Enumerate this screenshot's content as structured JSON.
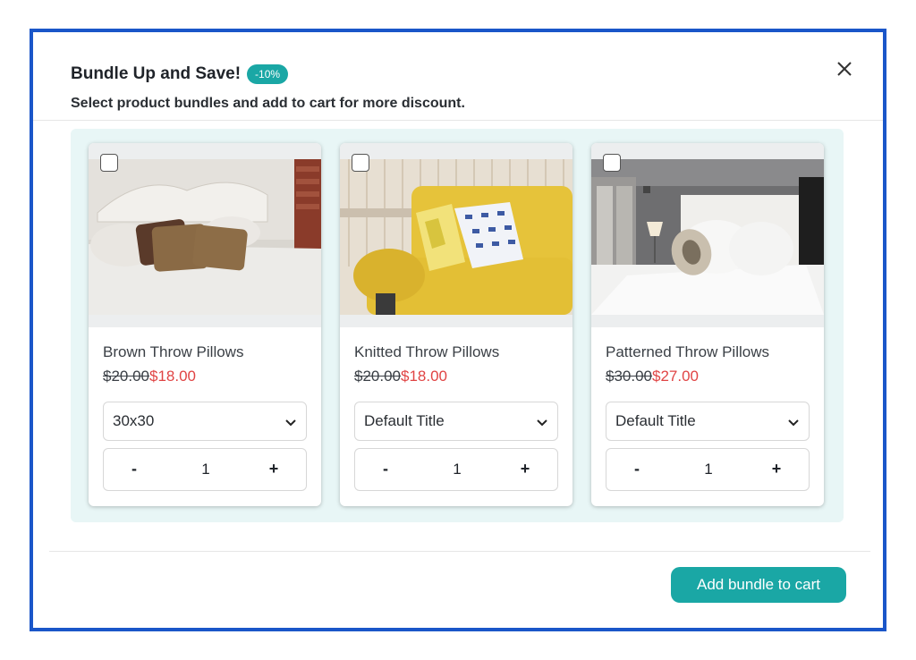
{
  "modal": {
    "title": "Bundle Up and Save!",
    "badge": "-10%",
    "subtitle": "Select product bundles and add to cart for more discount.",
    "add_button": "Add bundle to cart"
  },
  "products": [
    {
      "name": "Brown Throw Pillows",
      "old_price": "$20.00",
      "new_price": "$18.00",
      "variant": "30x30",
      "quantity": "1",
      "minus": "-",
      "plus": "+"
    },
    {
      "name": "Knitted Throw Pillows",
      "old_price": "$20.00",
      "new_price": "$18.00",
      "variant": "Default Title",
      "quantity": "1",
      "minus": "-",
      "plus": "+"
    },
    {
      "name": "Patterned Throw Pillows",
      "old_price": "$30.00",
      "new_price": "$27.00",
      "variant": "Default Title",
      "quantity": "1",
      "minus": "-",
      "plus": "+"
    }
  ],
  "colors": {
    "accent": "#1aa7a5",
    "border": "#1a56c9",
    "sale": "#e04444",
    "panel": "#e8f6f6"
  }
}
